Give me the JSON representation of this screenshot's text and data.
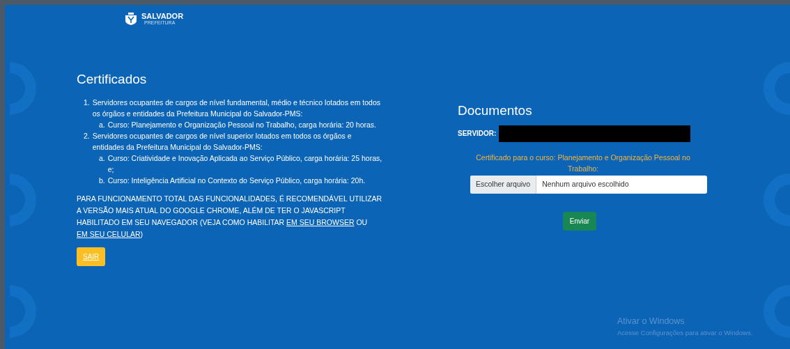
{
  "header": {
    "logo": {
      "title": "SALVADOR",
      "subtitle": "PREFEITURA"
    }
  },
  "certificados": {
    "title": "Certificados",
    "items": [
      {
        "marker": "1.",
        "text": "Servidores ocupantes de cargos de nível fundamental, médio e técnico lotados em todos os órgãos e entidades da Prefeitura Municipal do Salvador-PMS:",
        "children": [
          {
            "marker": "a.",
            "text": "Curso: Planejamento e Organização Pessoal no Trabalho, carga horária: 20 horas."
          }
        ]
      },
      {
        "marker": "2.",
        "text": "Servidores ocupantes de cargos de nível superior lotados em todos os órgãos e entidades da Prefeitura Municipal do Salvador-PMS:",
        "children": [
          {
            "marker": "a.",
            "text": "Curso: Criatividade e Inovação Aplicada ao Serviço Público, carga horária: 25 horas, e;"
          },
          {
            "marker": "b.",
            "text": "Curso: Inteligência Artificial no Contexto do Serviço Público, carga horária: 20h."
          }
        ]
      }
    ],
    "notice": [
      {
        "kind": "text",
        "text": "PARA FUNCIONAMENTO TOTAL DAS FUNCIONALIDADES, É RECOMENDÁVEL UTILIZAR A VERSÃO MAIS ATUAL DO GOOGLE CHROME, ALÉM DE TER O JAVASCRIPT HABILITADO EM SEU NAVEGADOR (VEJA COMO HABILITAR "
      },
      {
        "kind": "link",
        "text": "EM SEU BROWSER"
      },
      {
        "kind": "text",
        "text": " OU "
      },
      {
        "kind": "link",
        "text": "EM SEU CELULAR"
      },
      {
        "kind": "text",
        "text": ")"
      }
    ],
    "logout_button": "SAIR"
  },
  "documentos": {
    "title": "Documentos",
    "servidor_label": "SERVIDOR:",
    "course_label": "Certificado para o curso: Planejamento e Organização Pessoal no Trabalho:",
    "file_input": {
      "button": "Escolher arquivo",
      "value": "Nenhum arquivo escolhido"
    },
    "submit": "Enviar"
  },
  "os_overlay": {
    "title": "Ativar o Windows",
    "message": "Acesse Configurações para ativar o Windows."
  }
}
